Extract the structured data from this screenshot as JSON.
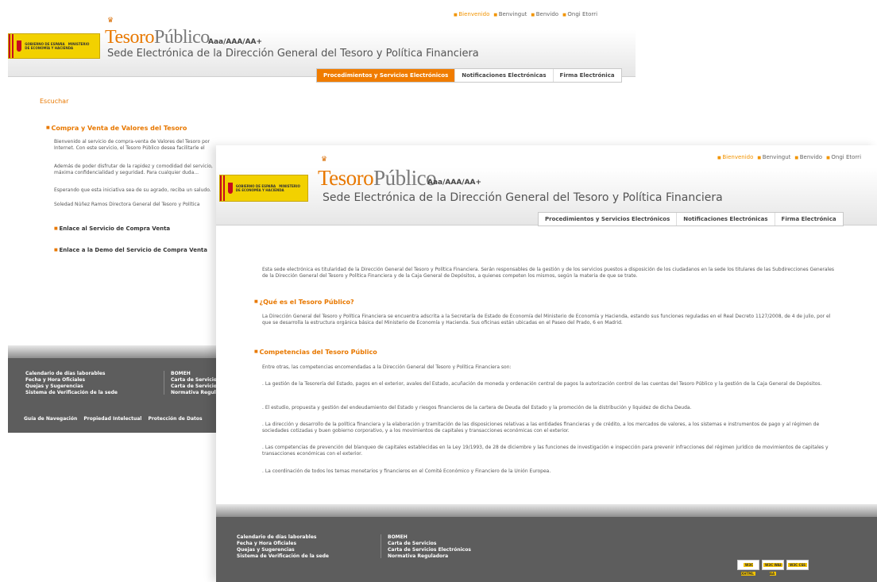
{
  "languages": [
    "Bienvenido",
    "Benvingut",
    "Benvido",
    "Ongi Etorri"
  ],
  "brand": {
    "name_part1": "Tesoro",
    "name_part2": "Público",
    "accessibility": "Aaa/AAA/AA+",
    "subtitle": "Sede Electrónica de la Dirección General del Tesoro y Política Financiera"
  },
  "tabs": [
    {
      "label": "Procedimientos y Servicios Electrónicos"
    },
    {
      "label": "Notificaciones Electrónicas"
    },
    {
      "label": "Firma Electrónica"
    }
  ],
  "back": {
    "escuchar": "Escuchar",
    "section_title": "Compra y Venta de Valores del Tesoro",
    "paragraphs": [
      "Bienvenido al servicio de compra-venta de Valores del Tesoro por Internet. Con este servicio, el Tesoro Público desea facilitarle el mismo...",
      "Además de poder disfrutar de la rapidez y comodidad del servicio, máxima confidencialidad y seguridad. Para cualquier duda...",
      "Esperando que esta iniciativa sea de su agrado, reciba un saludo.",
      "Soledad Núñez Ramos Directora General del Tesoro y Política Financiera"
    ],
    "links": [
      "Enlace al Servicio de Compra Venta",
      "Enlace a la Demo del Servicio de Compra Venta"
    ]
  },
  "front": {
    "intro": "Esta sede electrónica es titularidad de la Dirección General del Tesoro y Política Financiera. Serán responsables de la gestión y de los servicios puestos a disposición de los ciudadanos en la sede los titulares de las Subdirecciones Generales de la Dirección General del Tesoro y Política Financiera y de la Caja General de Depósitos, a quienes competen los mismos, según la materia de que se trate.",
    "q_title": "¿Qué es el Tesoro Público?",
    "q_text": "La Dirección General del Tesoro y Política Financiera se encuentra adscrita a la Secretaría de Estado de Economía del Ministerio de Economía y Hacienda, estando sus funciones reguladas en el Real Decreto 1127/2008, de 4 de julio, por el que se desarrolla la estructura orgánica básica del Ministerio de Economía y Hacienda. Sus oficinas están ubicadas en el Paseo del Prado, 6 en Madrid.",
    "comp_title": "Competencias del Tesoro Público",
    "comp_intro": "Entre otras, las competencias encomendadas a la Dirección General del Tesoro y Política Financiera son:",
    "comp_items": [
      ". La gestión de la Tesorería del Estado, pagos en el exterior, avales del Estado, acuñación de moneda y ordenación central de pagos la autorización control de las cuentas del Tesoro Público y la gestión de la Caja General de Depósitos.",
      ". El estudio, propuesta y gestión del endeudamiento del Estado y riesgos financieros de la cartera de Deuda del Estado y la promoción de la distribución y liquidez de dicha Deuda.",
      ". La dirección y desarrollo de la política financiera y la elaboración y tramitación de las disposiciones relativas a las entidades financieras y de crédito, a los mercados de valores, a los sistemas e instrumentos de pago y al régimen de sociedades cotizadas y buen gobierno corporativo, y a los movimientos de capitales y transacciones económicas con el exterior.",
      ". Las competencias de prevención del blanqueo de capitales establecidas en la Ley 19/1993, de 28 de diciembre y las funciones de investigación e inspección para prevenir infracciones del régimen jurídico de movimientos de capitales y transacciones económicas con el exterior.",
      ". La coordinación de todos los temas monetarios y financieros en el Comité Económico y Financiero de la Unión Europea."
    ]
  },
  "footer": {
    "col1": [
      "Calendario de días laborables",
      "Fecha y Hora Oficiales",
      "Quejas y Sugerencias",
      "Sistema de Verificación de la sede"
    ],
    "col2": [
      "BOMEH",
      "Carta de Servicios",
      "Carta de Servicios Electrónicos",
      "Normativa Reguladora"
    ],
    "bottom_links": [
      "Guía de Navegación",
      "Propiedad Intelectual",
      "Protección de Datos"
    ],
    "wcag": [
      "W3C XHTML",
      "W3C WAI-AA",
      "W3C CSS"
    ]
  }
}
